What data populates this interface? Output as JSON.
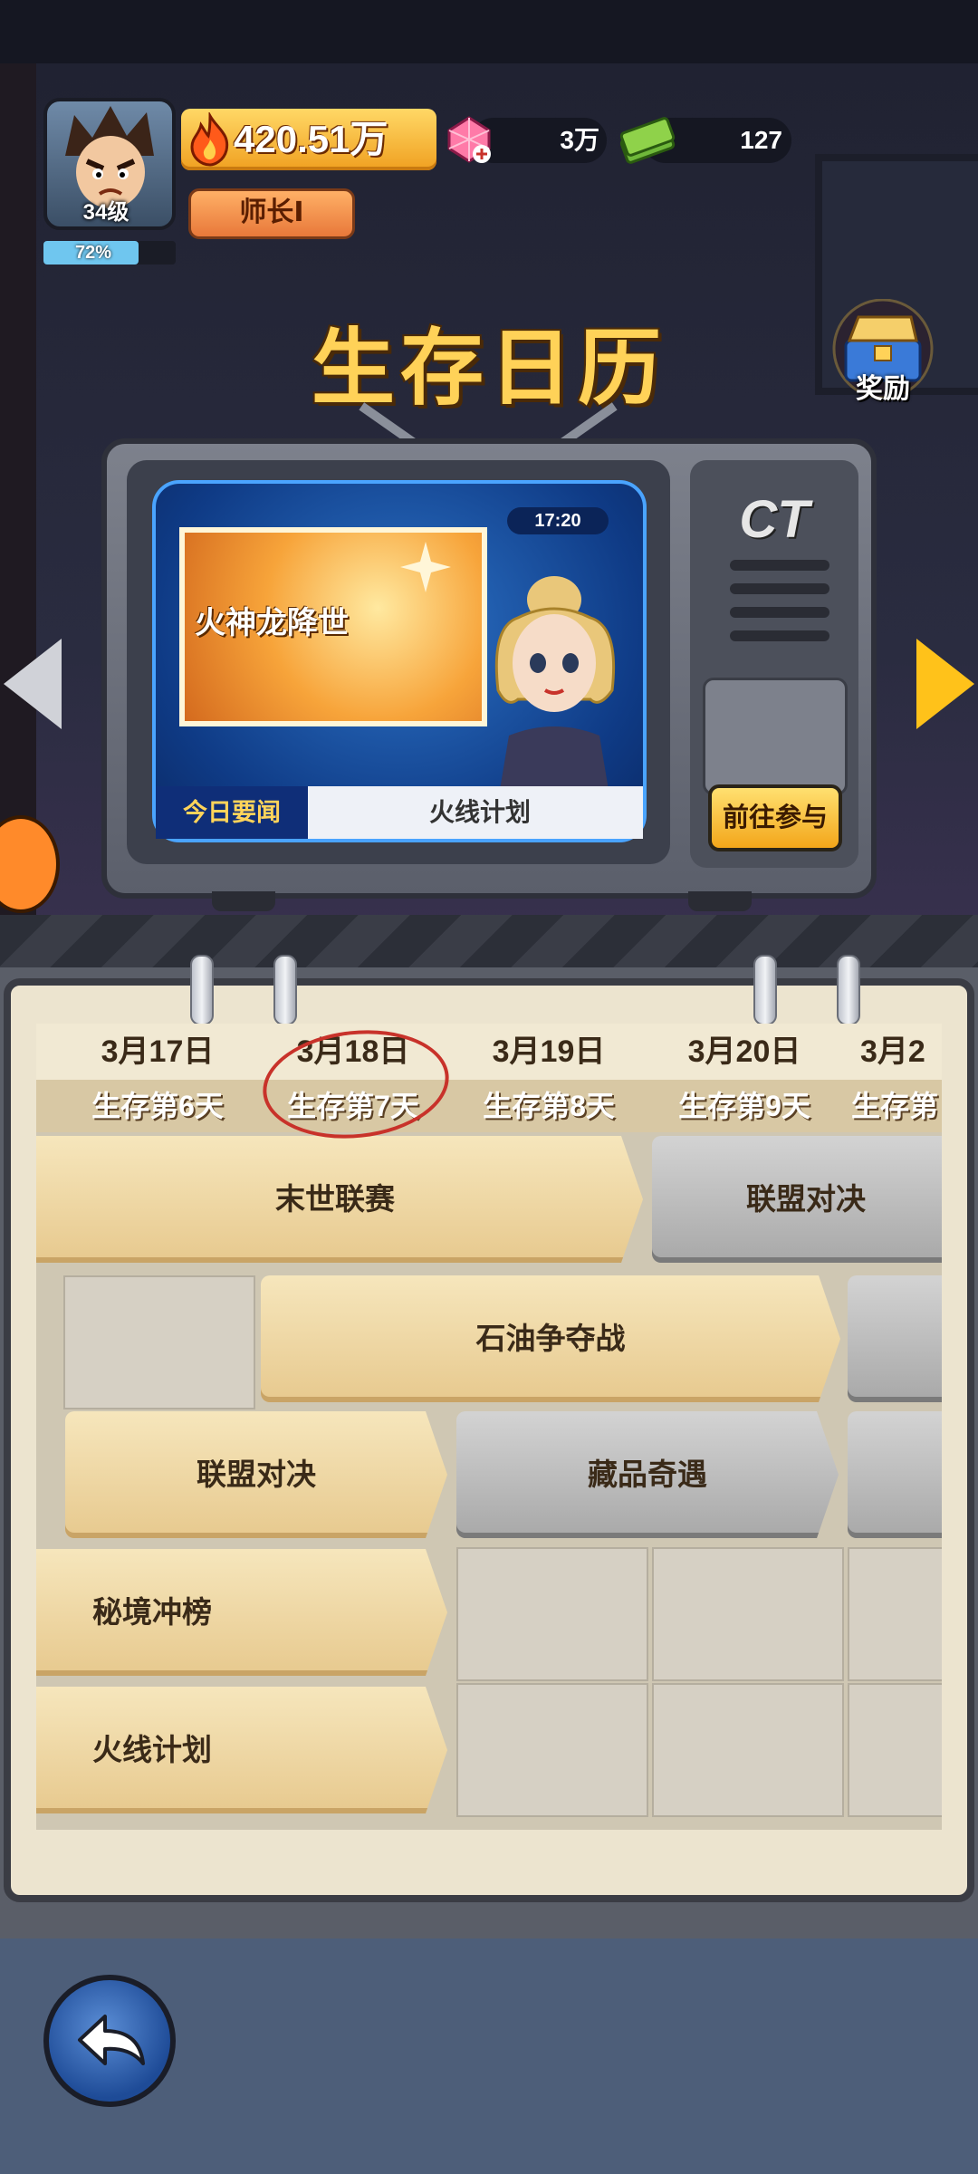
{
  "player": {
    "level": "34级",
    "xp_percent": "72%",
    "xp_fraction": 0.72,
    "power": "420.51万",
    "rank": "师长Ⅰ"
  },
  "resources": {
    "gems": "3万",
    "cash": "127"
  },
  "page_title": "生存日历",
  "reward_label": "奖励",
  "tv": {
    "news_title": "火神龙降世",
    "time": "17:20",
    "brand": "CT",
    "banner_label": "今日要闻",
    "banner_text": "火线计划",
    "go_button": "前往参与"
  },
  "calendar": {
    "dates": [
      "3月17日",
      "3月18日",
      "3月19日",
      "3月20日",
      "3月2"
    ],
    "days": [
      "生存第6天",
      "生存第7天",
      "生存第8天",
      "生存第9天",
      "生存第"
    ],
    "events": {
      "row1_a": "末世联赛",
      "row1_b": "联盟对决",
      "row2_a": "石油争夺战",
      "row3_a": "联盟对决",
      "row3_b": "藏品奇遇",
      "row4_a": "秘境冲榜",
      "row5_a": "火线计划"
    }
  },
  "colors": {
    "title": "#ffd258",
    "event_active": "#f6e6bc",
    "event_inactive": "#a8a8a8",
    "today_circle": "#c8322a"
  }
}
